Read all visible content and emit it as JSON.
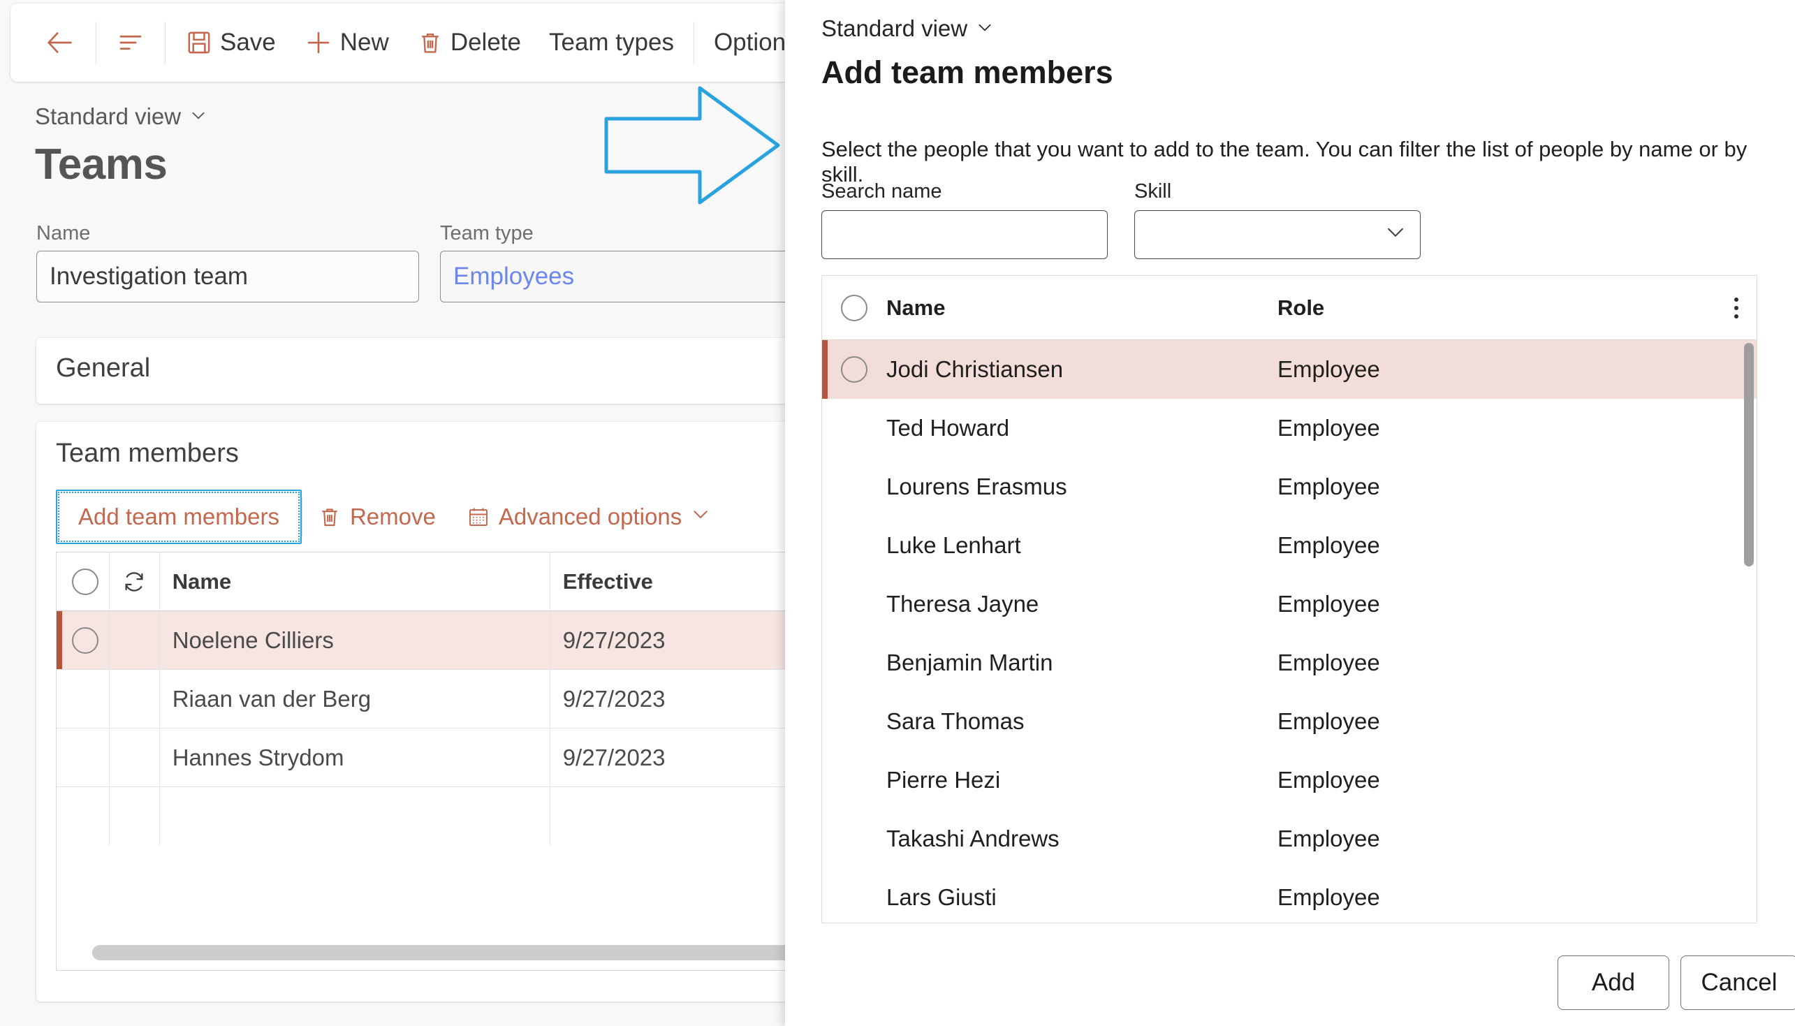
{
  "left": {
    "command_bar": {
      "back_label": "",
      "items": [
        {
          "label": "Save",
          "icon": "save-icon"
        },
        {
          "label": "New",
          "icon": "plus-icon"
        },
        {
          "label": "Delete",
          "icon": "trash-icon"
        },
        {
          "label": "Team types",
          "icon": "none"
        },
        {
          "label": "Options",
          "icon": "none"
        }
      ]
    },
    "view_selector": "Standard view",
    "page_title": "Teams",
    "fields": {
      "name_label": "Name",
      "name_value": "Investigation team",
      "teamtype_label": "Team type",
      "teamtype_value": "Employees"
    },
    "general_card_title": "General",
    "members_card_title": "Team members",
    "grid_toolbar": {
      "add_label": "Add team members",
      "remove_label": "Remove",
      "advanced_label": "Advanced options"
    },
    "grid": {
      "columns": [
        "Name",
        "Effective"
      ],
      "rows": [
        {
          "name": "Noelene Cilliers",
          "effective": "9/27/2023",
          "selected": true
        },
        {
          "name": "Riaan van der Berg",
          "effective": "9/27/2023",
          "selected": false
        },
        {
          "name": "Hannes Strydom",
          "effective": "9/27/2023",
          "selected": false
        }
      ]
    }
  },
  "dialog": {
    "view_selector": "Standard view",
    "title": "Add team members",
    "description": "Select the people that you want to add to the team. You can filter the list of people by name or by skill.",
    "search_name_label": "Search name",
    "search_name_value": "",
    "skill_label": "Skill",
    "skill_value": "",
    "columns": {
      "name": "Name",
      "role": "Role"
    },
    "rows": [
      {
        "name": "Jodi Christiansen",
        "role": "Employee",
        "selected": true
      },
      {
        "name": "Ted Howard",
        "role": "Employee",
        "selected": false
      },
      {
        "name": "Lourens Erasmus",
        "role": "Employee",
        "selected": false
      },
      {
        "name": "Luke Lenhart",
        "role": "Employee",
        "selected": false
      },
      {
        "name": "Theresa Jayne",
        "role": "Employee",
        "selected": false
      },
      {
        "name": "Benjamin Martin",
        "role": "Employee",
        "selected": false
      },
      {
        "name": "Sara Thomas",
        "role": "Employee",
        "selected": false
      },
      {
        "name": "Pierre Hezi",
        "role": "Employee",
        "selected": false
      },
      {
        "name": "Takashi Andrews",
        "role": "Employee",
        "selected": false
      },
      {
        "name": "Lars Giusti",
        "role": "Employee",
        "selected": false
      }
    ],
    "add_button": "Add",
    "cancel_button": "Cancel"
  },
  "annotation": {
    "shape": "right-arrow",
    "color": "#29a3e0"
  },
  "colors": {
    "accent_orange": "#c3684f",
    "selection_row": "#f3ddd8",
    "selection_bar": "#b8543c",
    "annotation_blue": "#29a3e0",
    "link_blue": "#6b86ef"
  }
}
